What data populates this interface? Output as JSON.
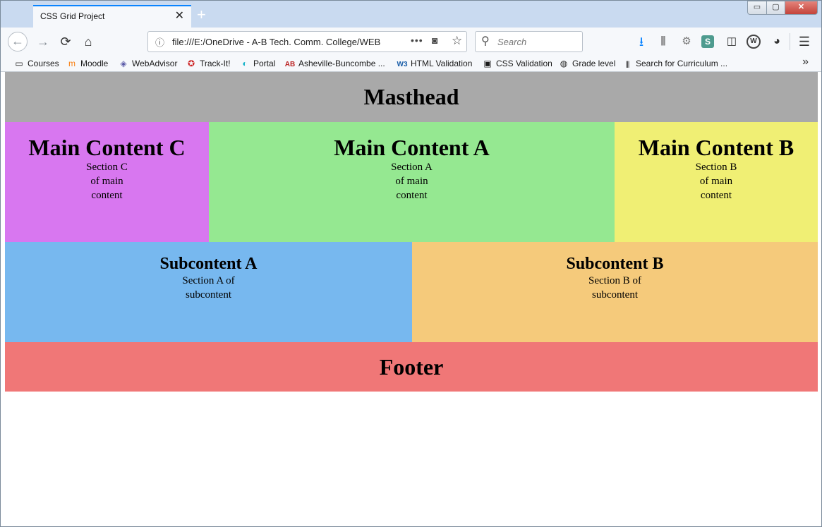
{
  "browser": {
    "tab_title": "CSS Grid Project",
    "tab_close": "✕",
    "new_tab": "+",
    "window_controls": {
      "minimize": "▭",
      "maximize": "▢",
      "close": "✕"
    },
    "nav": {
      "back": "←",
      "forward": "→",
      "reload": "⟳",
      "home": "⌂"
    },
    "url": "file:///E:/OneDrive - A-B Tech. Comm. College/WEB",
    "url_more": "•••",
    "search_placeholder": "Search",
    "toolbar_icons": [
      "download-icon",
      "library-icon",
      "gear-icon",
      "s-extension-icon",
      "sidebar-icon",
      "w-extension-icon",
      "color-extension-icon",
      "menu-icon"
    ]
  },
  "bookmarks": [
    {
      "label": "Courses",
      "icon": "folder-icon",
      "glyph": "▭"
    },
    {
      "label": "Moodle",
      "icon": "moodle-icon",
      "glyph": "m"
    },
    {
      "label": "WebAdvisor",
      "icon": "webadvisor-icon",
      "glyph": "◈"
    },
    {
      "label": "Track-It!",
      "icon": "trackit-icon",
      "glyph": "✪"
    },
    {
      "label": "Portal",
      "icon": "portal-icon",
      "glyph": "◐"
    },
    {
      "label": "Asheville-Buncombe ...",
      "icon": "ab-logo-icon",
      "glyph": "AB"
    },
    {
      "label": "HTML Validation",
      "icon": "w3c-icon",
      "glyph": "W3"
    },
    {
      "label": "CSS Validation",
      "icon": "css-validation-icon",
      "glyph": "▣"
    },
    {
      "label": "Grade level",
      "icon": "globe-icon",
      "glyph": "◍"
    },
    {
      "label": "Search for Curriculum ...",
      "icon": "barcode-icon",
      "glyph": "|||"
    }
  ],
  "bookmarks_more": "»",
  "page": {
    "masthead": "Masthead",
    "main_c": {
      "title": "Main Content C",
      "text": "Section C of main content"
    },
    "main_a": {
      "title": "Main Content A",
      "text": "Section A of main content"
    },
    "main_b": {
      "title": "Main Content B",
      "text": "Section B of main content"
    },
    "sub_a": {
      "title": "Subcontent A",
      "text": "Section A of subcontent"
    },
    "sub_b": {
      "title": "Subcontent B",
      "text": "Section B of subcontent"
    },
    "footer": "Footer"
  },
  "colors": {
    "masthead": "#a9a9a9",
    "main_c": "#d877f0",
    "main_a": "#95e891",
    "main_b": "#f0ef74",
    "sub_a": "#77b8ef",
    "sub_b": "#f5ca7b",
    "footer": "#f07777"
  }
}
